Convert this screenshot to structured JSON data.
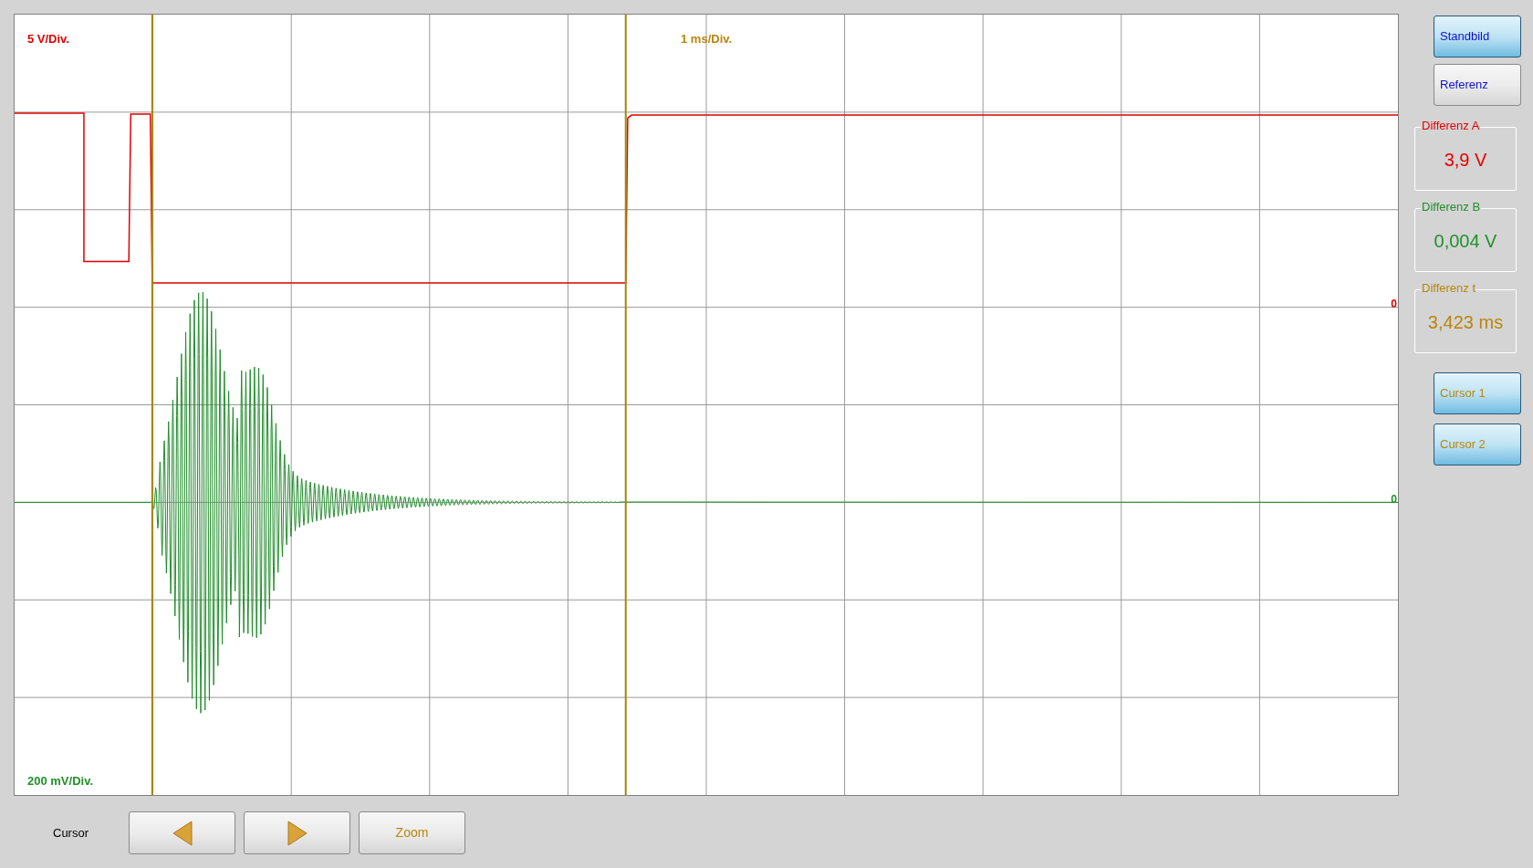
{
  "plot": {
    "channel_a_scale": "5 V/Div.",
    "time_scale": "1 ms/Div.",
    "channel_b_scale": "200 mV/Div.",
    "channel_a_zero_marker": "0",
    "channel_b_zero_marker": "0"
  },
  "side_buttons": [
    {
      "kind": "mode",
      "label": "Standbild",
      "on": true
    },
    {
      "kind": "mode",
      "label": "Referenz",
      "on": false
    }
  ],
  "readouts": [
    {
      "label": "Differenz A",
      "value": "3,9 V",
      "color": "#e60000"
    },
    {
      "label": "Differenz B",
      "value": "0,004 V",
      "color": "#21912b"
    },
    {
      "label": "Differenz t",
      "value": "3,423 ms",
      "color": "#b8860b"
    }
  ],
  "cursor_buttons": [
    {
      "kind": "cursor",
      "label": "Cursor 1",
      "on": true
    },
    {
      "kind": "cursor",
      "label": "Cursor 2",
      "on": true
    }
  ],
  "bottom_bar": {
    "label": "Cursor",
    "buttons": [
      {
        "kind": "left"
      },
      {
        "kind": "right"
      },
      {
        "kind": "text",
        "label": "Zoom"
      }
    ]
  }
}
